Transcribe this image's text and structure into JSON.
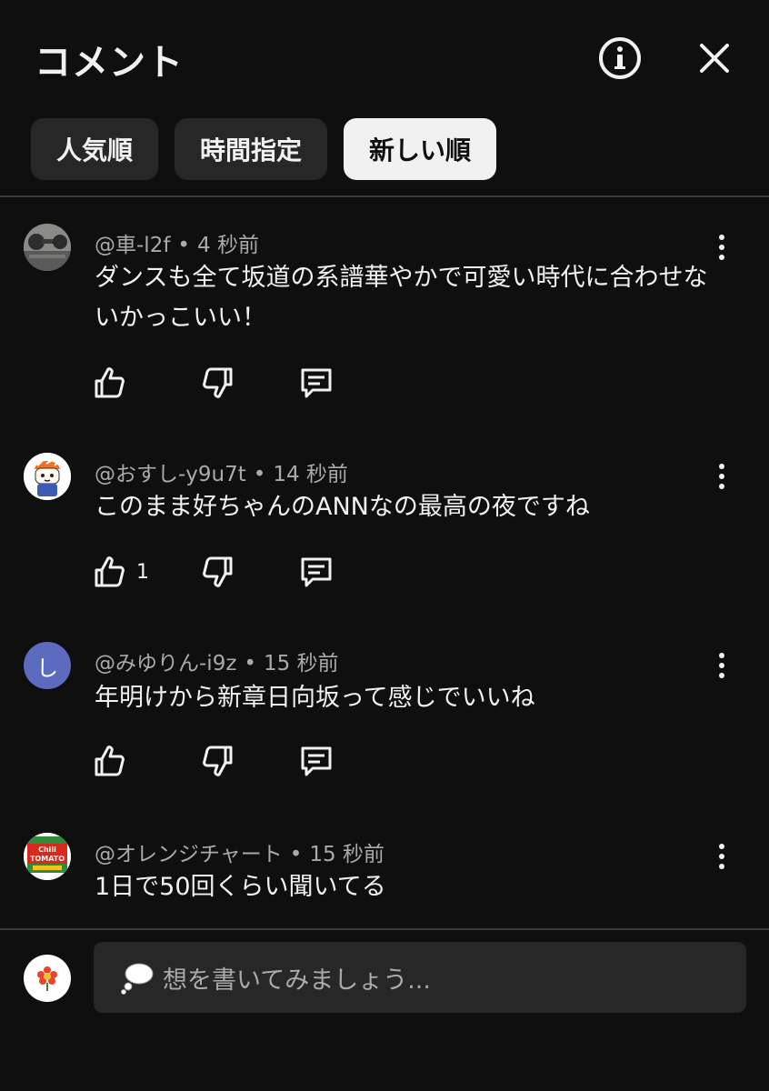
{
  "header": {
    "title": "コメント",
    "info_icon": "info-circle-icon",
    "close_icon": "close-x-icon"
  },
  "sort_chips": [
    {
      "label": "人気順",
      "active": false
    },
    {
      "label": "時間指定",
      "active": false
    },
    {
      "label": "新しい順",
      "active": true
    }
  ],
  "comments": [
    {
      "user": "@車-l2f",
      "time": "4 秒前",
      "text": "ダンスも全て坂道の系譜華やかで可愛い時代に合わせないかっこいい！",
      "likes": "",
      "avatar": "photo-avatar"
    },
    {
      "user": "@おすし-y9u7t",
      "time": "14 秒前",
      "text": "このまま好ちゃんのANNなの最高の夜ですね",
      "likes": "1",
      "avatar": "sushi-character-avatar"
    },
    {
      "user": "@みゆりん-i9z",
      "time": "15 秒前",
      "text": "年明けから新章日向坂って感じでいいね",
      "likes": "",
      "avatar_letter": "し"
    },
    {
      "user": "@オレンジチャート",
      "time": "15 秒前",
      "text": "1日で50回くらい聞いてる",
      "likes": "",
      "avatar": "chili-tomato-cup-avatar",
      "avatar_text_1": "Chili",
      "avatar_text_2": "TOMATO"
    }
  ],
  "composer": {
    "placeholder": "想を書いてみましょう...",
    "emoji_icon": "thought-bubble-icon",
    "avatar_icon": "flower-icon"
  },
  "colors": {
    "background": "#0f0f0f",
    "chip": "#272727",
    "chip_active": "#f1f1f1",
    "secondary_text": "#aaaaaa",
    "letter_avatar": "#5c6bc0"
  }
}
